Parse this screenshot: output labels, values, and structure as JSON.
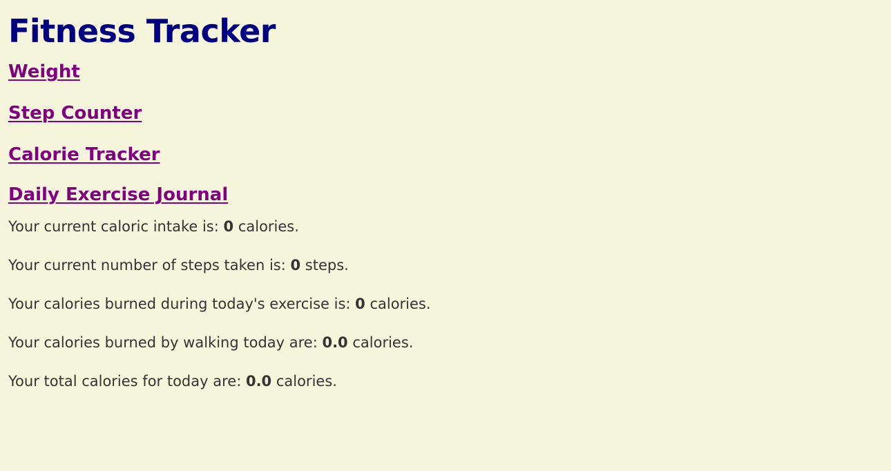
{
  "header": {
    "title": "Fitness Tracker"
  },
  "nav": {
    "links": [
      {
        "label": "Weight"
      },
      {
        "label": "Step Counter"
      },
      {
        "label": "Calorie Tracker"
      },
      {
        "label": "Daily Exercise Journal"
      }
    ]
  },
  "stats": [
    {
      "prefix": "Your current caloric intake is: ",
      "value": "0",
      "suffix": " calories."
    },
    {
      "prefix": "Your current number of steps taken is: ",
      "value": "0",
      "suffix": " steps."
    },
    {
      "prefix": "Your calories burned during today's exercise is: ",
      "value": "0",
      "suffix": " calories."
    },
    {
      "prefix": "Your calories burned by walking today are: ",
      "value": "0.0",
      "suffix": " calories."
    },
    {
      "prefix": "Your total calories for today are: ",
      "value": "0.0",
      "suffix": " calories."
    }
  ],
  "colors": {
    "background": "#f5f5dc",
    "title": "#000080",
    "link": "#800080",
    "text": "#333333"
  }
}
